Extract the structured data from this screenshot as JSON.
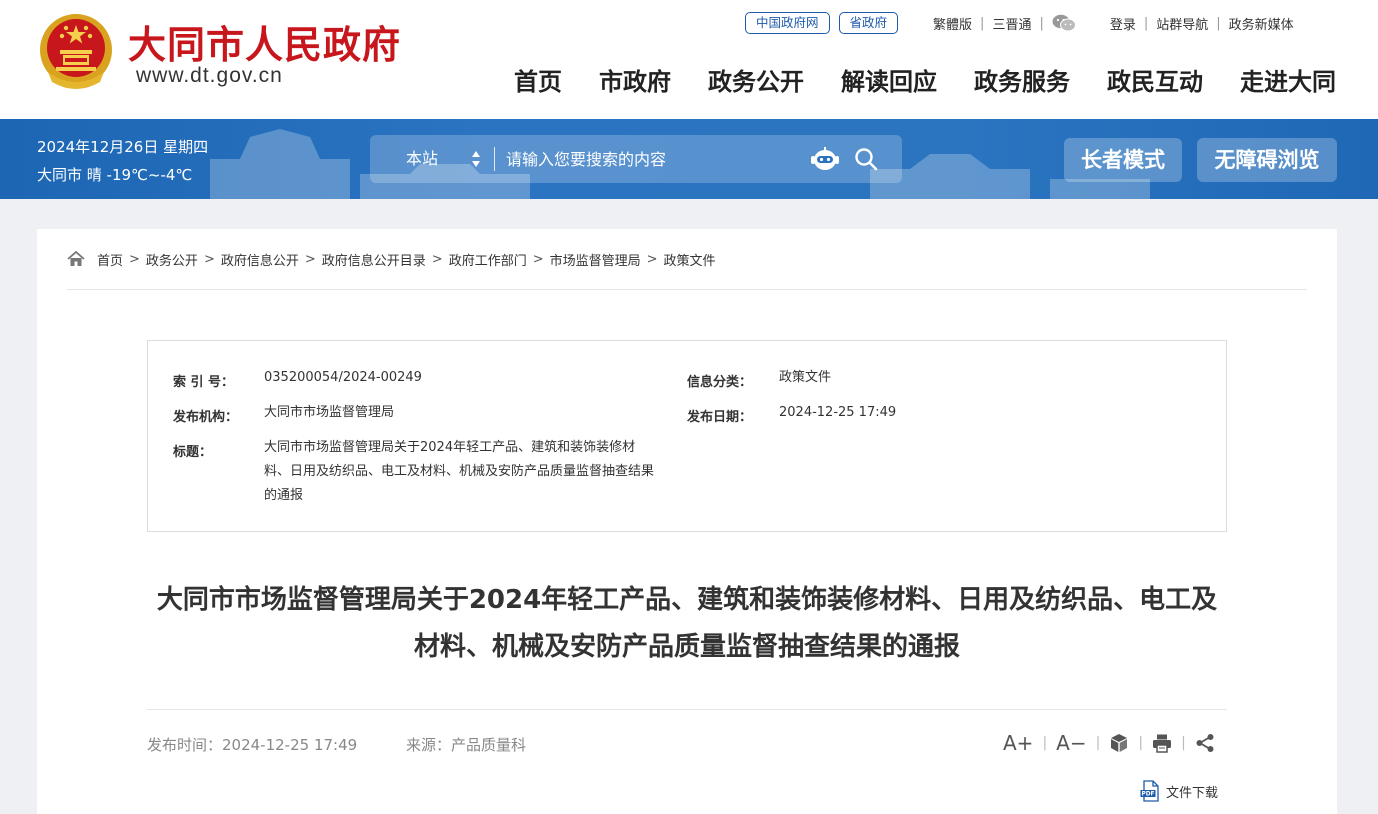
{
  "header": {
    "site_title": "大同市人民政府",
    "site_url": "www.dt.gov.cn",
    "top_links": {
      "gov_cn": "中国政府网",
      "province": "省政府",
      "traditional": "繁體版",
      "sanjin": "三晋通",
      "login": "登录",
      "site_nav": "站群导航",
      "new_media": "政务新媒体"
    },
    "nav": [
      "首页",
      "市政府",
      "政务公开",
      "解读回应",
      "政务服务",
      "政民互动",
      "走进大同"
    ]
  },
  "band": {
    "date": "2024年12月26日  星期四",
    "weather": "大同市  晴  -19℃~-4℃",
    "search": {
      "scope": "本站",
      "placeholder": "请输入您要搜索的内容"
    },
    "elder_mode": "长者模式",
    "accessible": "无障碍浏览"
  },
  "breadcrumb": [
    "首页",
    "政务公开",
    "政府信息公开",
    "政府信息公开目录",
    "政府工作部门",
    "市场监督管理局",
    "政策文件"
  ],
  "breadcrumb_sep": ">",
  "meta": {
    "index_label": "索 引 号：",
    "index_value": "035200054/2024-00249",
    "category_label": "信息分类：",
    "category_value": "政策文件",
    "publisher_label": "发布机构：",
    "publisher_value": "大同市市场监督管理局",
    "date_label": "发布日期：",
    "date_value": "2024-12-25 17:49",
    "title_label": "标题：",
    "title_value": "大同市市场监督管理局关于2024年轻工产品、建筑和装饰装修材料、日用及纺织品、电工及材料、机械及安防产品质量监督抽查结果的通报"
  },
  "article": {
    "title": "大同市市场监督管理局关于2024年轻工产品、建筑和装饰装修材料、日用及纺织品、电工及材料、机械及安防产品质量监督抽查结果的通报",
    "pub_time": "发布时间：2024-12-25 17:49",
    "source": "来源：产品质量科",
    "tools": {
      "font_up": "A+",
      "font_down": "A−"
    },
    "download": "文件下载"
  },
  "colors": {
    "brand_red": "#c8161d",
    "band_blue": "#2a72bf",
    "link_blue": "#1e5bab"
  }
}
